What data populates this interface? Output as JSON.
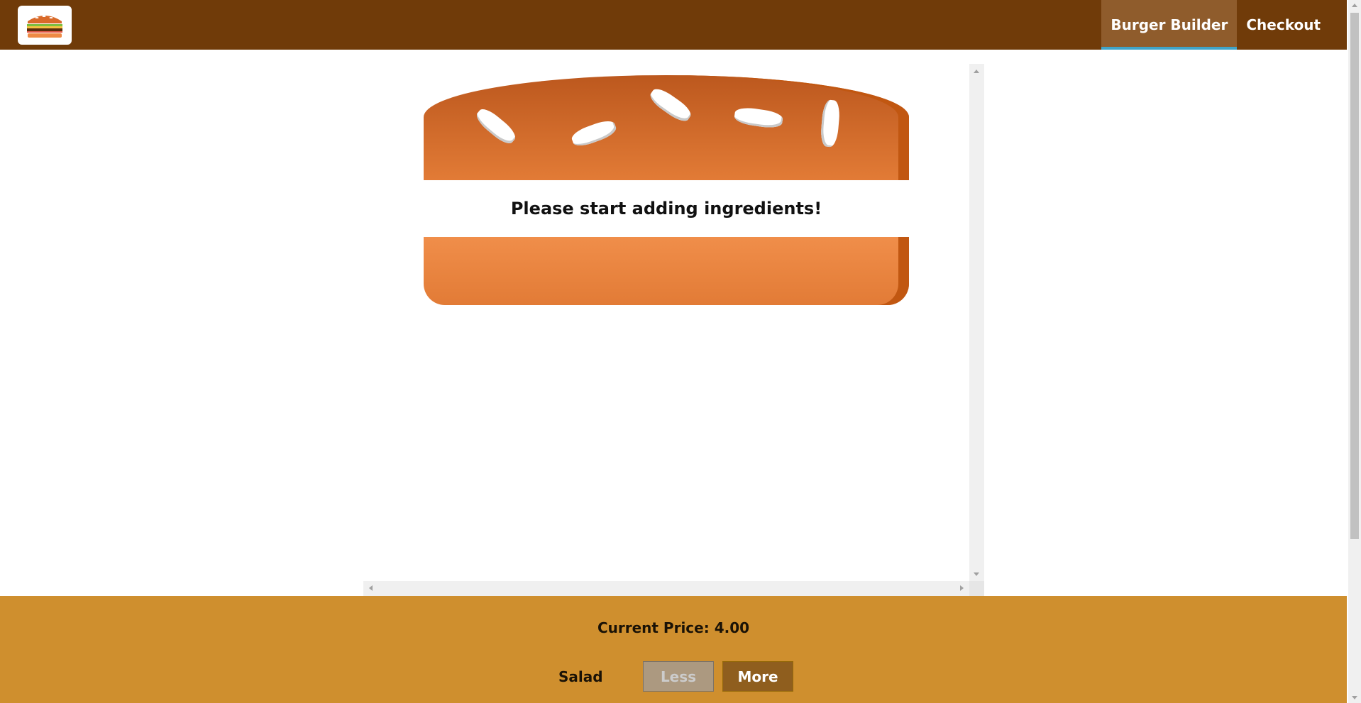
{
  "toolbar": {
    "logo": "burger-logo-icon",
    "nav": {
      "burger_builder": "Burger Builder",
      "checkout": "Checkout"
    },
    "colors": {
      "background": "#703b09",
      "active": "#8f5c2c",
      "active_underline": "#40a4c8"
    }
  },
  "burger": {
    "empty_message": "Please start adding ingredients!"
  },
  "build_controls": {
    "price_label": "Current Price:",
    "price_value": "4.00",
    "controls": [
      {
        "label": "Salad",
        "less": "Less",
        "more": "More",
        "less_disabled": true
      }
    ],
    "colors": {
      "background": "#cf8f2e",
      "more_button": "#8f5e1e",
      "less_button_disabled": "#ac9980"
    }
  }
}
